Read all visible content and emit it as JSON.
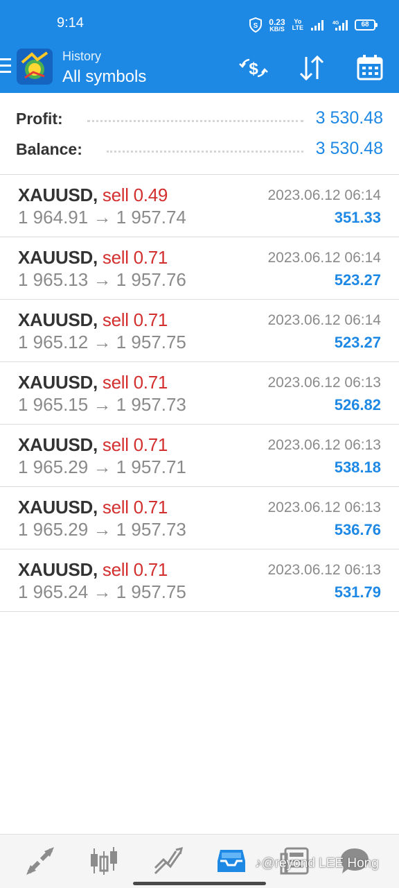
{
  "status_bar": {
    "time": "9:14",
    "net_speed_value": "0.23",
    "net_speed_unit": "KB/S",
    "volte_top": "Yo",
    "volte_bottom": "LTE",
    "battery": "68"
  },
  "header": {
    "subtitle": "History",
    "title": "All symbols",
    "icons": [
      "menu-icon",
      "mt-logo-icon",
      "deposit-dollar-icon",
      "sort-arrows-icon",
      "calendar-icon"
    ]
  },
  "summary": {
    "profit_label": "Profit:",
    "profit_value": "3 530.48",
    "balance_label": "Balance:",
    "balance_value": "3 530.48"
  },
  "deals": [
    {
      "symbol": "XAUUSD",
      "side": "sell",
      "volume": "0.49",
      "open_price": "1 964.91",
      "close_price": "1 957.74",
      "time": "2023.06.12 06:14",
      "profit": "351.33"
    },
    {
      "symbol": "XAUUSD",
      "side": "sell",
      "volume": "0.71",
      "open_price": "1 965.13",
      "close_price": "1 957.76",
      "time": "2023.06.12 06:14",
      "profit": "523.27"
    },
    {
      "symbol": "XAUUSD",
      "side": "sell",
      "volume": "0.71",
      "open_price": "1 965.12",
      "close_price": "1 957.75",
      "time": "2023.06.12 06:14",
      "profit": "523.27"
    },
    {
      "symbol": "XAUUSD",
      "side": "sell",
      "volume": "0.71",
      "open_price": "1 965.15",
      "close_price": "1 957.73",
      "time": "2023.06.12 06:13",
      "profit": "526.82"
    },
    {
      "symbol": "XAUUSD",
      "side": "sell",
      "volume": "0.71",
      "open_price": "1 965.29",
      "close_price": "1 957.71",
      "time": "2023.06.12 06:13",
      "profit": "538.18"
    },
    {
      "symbol": "XAUUSD",
      "side": "sell",
      "volume": "0.71",
      "open_price": "1 965.29",
      "close_price": "1 957.73",
      "time": "2023.06.12 06:13",
      "profit": "536.76"
    },
    {
      "symbol": "XAUUSD",
      "side": "sell",
      "volume": "0.71",
      "open_price": "1 965.24",
      "close_price": "1 957.75",
      "time": "2023.06.12 06:13",
      "profit": "531.79"
    }
  ],
  "deal_separators": {
    "comma": ",",
    "arrow": "→"
  },
  "bottom_nav": {
    "items": [
      "quotes-icon",
      "chart-candles-icon",
      "trade-icon",
      "history-inbox-icon",
      "news-icon",
      "chat-icon"
    ],
    "active": "history-inbox-icon"
  },
  "watermark": "♪@reyond LEE Hong",
  "colors": {
    "accent": "#1e88e5",
    "sell": "#d32f2f",
    "profit": "#1e88e5",
    "muted": "#8a8a8a",
    "text": "#333333"
  }
}
